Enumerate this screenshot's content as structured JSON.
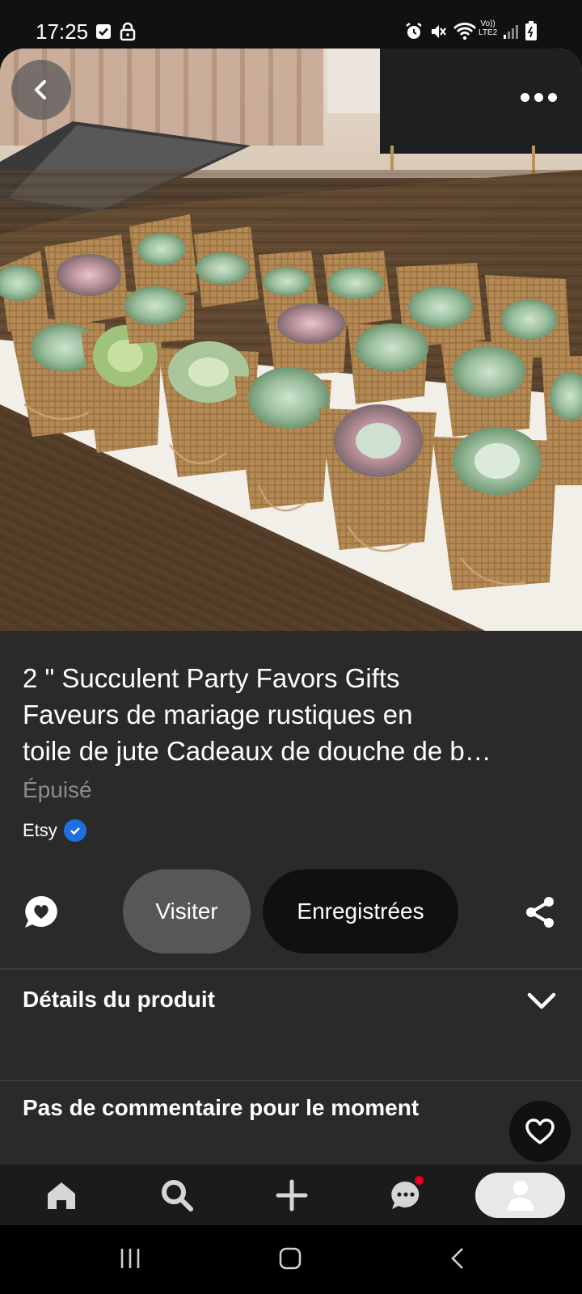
{
  "status_bar": {
    "time": "17:25",
    "network_label_top": "Vo))",
    "network_label_bottom": "LTE2"
  },
  "pin": {
    "title_lines": [
      "2 \" Succulent Party Favors Gifts",
      "Faveurs de mariage rustiques en",
      "toile de jute Cadeaux de douche de b…"
    ],
    "availability": "Épuisé",
    "merchant": "Etsy",
    "merchant_verified": true
  },
  "actions": {
    "visit_label": "Visiter",
    "saved_label": "Enregistrées"
  },
  "sections": {
    "product_details": "Détails du produit",
    "comments": "Pas de commentaire pour le moment"
  },
  "colors": {
    "panel_bg": "#2a2a2a",
    "visit_bg": "#575757",
    "saved_bg": "#101010",
    "verified_blue": "#1f6fe0",
    "notification_red": "#e60023"
  },
  "icons": {
    "back": "chevron-left-icon",
    "more": "more-horizontal-icon",
    "comment": "speech-bubble-heart-icon",
    "share": "share-icon",
    "expand": "chevron-down-icon",
    "like": "heart-outline-icon",
    "nav": [
      "home-icon",
      "search-icon",
      "plus-icon",
      "messages-icon",
      "profile-icon"
    ]
  }
}
